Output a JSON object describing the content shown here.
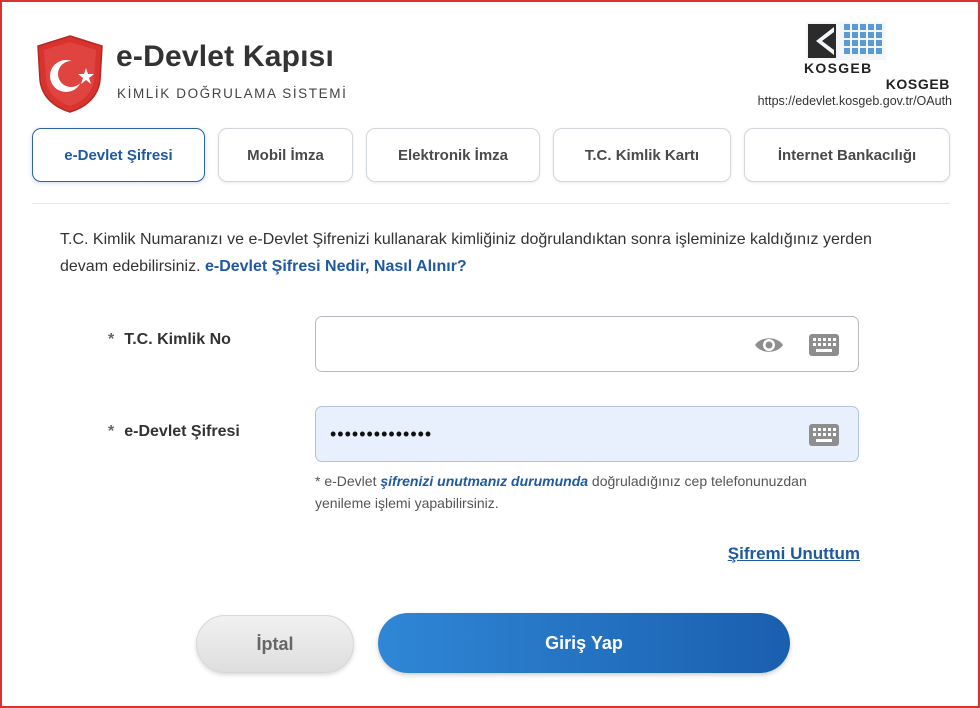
{
  "brand": {
    "title": "e-Devlet Kapısı",
    "subtitle": "KİMLİK DOĞRULAMA SİSTEMİ",
    "accent": "#d9332f"
  },
  "client": {
    "logo_text": "KOSGEB",
    "name": "KOSGEB",
    "url": "https://edevlet.kosgeb.gov.tr/OAuth"
  },
  "tabs": [
    {
      "label": "e-Devlet Şifresi",
      "active": true
    },
    {
      "label": "Mobil İmza",
      "active": false
    },
    {
      "label": "Elektronik İmza",
      "active": false
    },
    {
      "label": "T.C. Kimlik Kartı",
      "active": false
    },
    {
      "label": "İnternet Bankacılığı",
      "active": false
    }
  ],
  "intro": {
    "text": "T.C. Kimlik Numaranızı ve e-Devlet Şifrenizi kullanarak kimliğiniz doğrulandıktan sonra işleminize kaldığınız yerden devam edebilirsiniz.",
    "link": "e-Devlet Şifresi Nedir, Nasıl Alınır?"
  },
  "form": {
    "required_mark": "*",
    "tc_label": "T.C. Kimlik No",
    "tc_value": "",
    "password_label": "e-Devlet Şifresi",
    "password_value": "••••••••••••••",
    "hint_prefix": "* e-Devlet",
    "hint_emphasis": "şifrenizi unutmanız durumunda",
    "hint_suffix": "doğruladığınız cep telefonunuzdan yenileme işlemi yapabilirsiniz.",
    "forgot_link": "Şifremi Unuttum"
  },
  "actions": {
    "cancel": "İptal",
    "login": "Giriş Yap"
  },
  "colors": {
    "link_blue": "#1f5aa0",
    "button_blue": "#2f87d6",
    "filled_field": "#e8f0fd"
  }
}
